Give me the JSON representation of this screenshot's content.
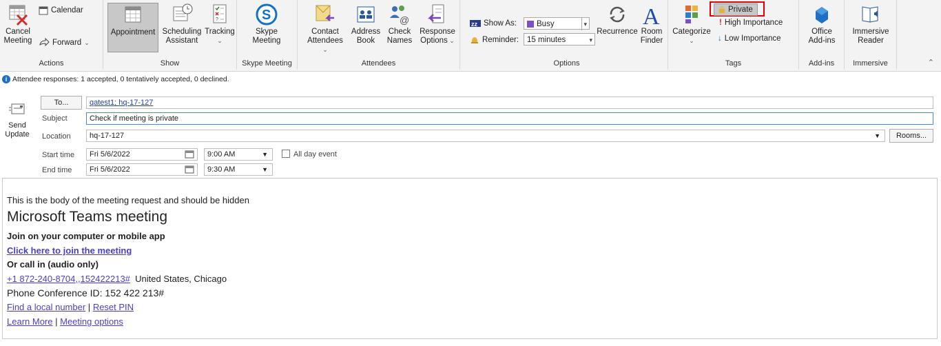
{
  "ribbon": {
    "actions": {
      "cancel_line1": "Cancel",
      "cancel_line2": "Meeting",
      "calendar": "Calendar",
      "forward": "Forward",
      "group": "Actions"
    },
    "show": {
      "appointment": "Appointment",
      "scheduling_line1": "Scheduling",
      "scheduling_line2": "Assistant",
      "tracking": "Tracking",
      "group": "Show"
    },
    "skype": {
      "line1": "Skype",
      "line2": "Meeting",
      "group": "Skype Meeting"
    },
    "attendees": {
      "contact_line1": "Contact",
      "contact_line2": "Attendees",
      "address_line1": "Address",
      "address_line2": "Book",
      "check_line1": "Check",
      "check_line2": "Names",
      "response_line1": "Response",
      "response_line2": "Options",
      "group": "Attendees"
    },
    "options": {
      "show_as_label": "Show As:",
      "show_as_value": "Busy",
      "reminder_label": "Reminder:",
      "reminder_value": "15 minutes",
      "recurrence": "Recurrence",
      "room_line1": "Room",
      "room_line2": "Finder",
      "group": "Options"
    },
    "tags": {
      "categorize": "Categorize",
      "private": "Private",
      "high": "High Importance",
      "low": "Low Importance",
      "group": "Tags"
    },
    "addins": {
      "line1": "Office",
      "line2": "Add-ins",
      "group": "Add-ins"
    },
    "immersive": {
      "line1": "Immersive",
      "line2": "Reader",
      "group": "Immersive"
    }
  },
  "info": "Attendee responses: 1 accepted, 0 tentatively accepted, 0 declined.",
  "form": {
    "send_line1": "Send",
    "send_line2": "Update",
    "to_button": "To...",
    "to_value": "qatest1; hq-17-127",
    "subject_label": "Subject",
    "subject_value": "Check if meeting is private",
    "location_label": "Location",
    "location_value": "hq-17-127",
    "rooms_button": "Rooms...",
    "start_label": "Start time",
    "start_date": "Fri 5/6/2022",
    "start_time": "9:00 AM",
    "all_day": "All day event",
    "end_label": "End time",
    "end_date": "Fri 5/6/2022",
    "end_time": "9:30 AM"
  },
  "body": {
    "line1": "This is the body of the meeting request and should be hidden",
    "teams_title": "Microsoft Teams meeting",
    "join_heading": "Join on your computer or mobile app",
    "join_link": "Click here to join the meeting",
    "call_heading": "Or call in (audio only)",
    "phone_link": "+1 872-240-8704,,152422213#",
    "phone_location": "United States, Chicago",
    "conference_id": "Phone Conference ID: 152 422 213#",
    "find_local": "Find a local number",
    "sep": "|",
    "reset_pin": "Reset PIN",
    "learn_more": "Learn More",
    "meeting_options": "Meeting options"
  },
  "colors": {
    "highlight_box": "#e00000",
    "link": "#4b3fc1",
    "skype_blue": "#1670c8",
    "info_blue": "#1f6fc5"
  }
}
